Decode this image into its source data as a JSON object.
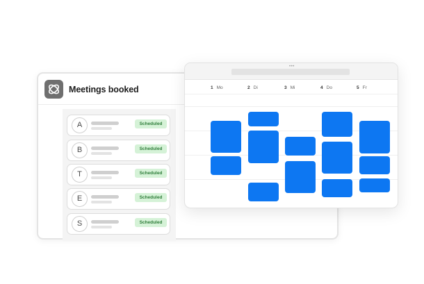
{
  "meetings": {
    "title": "Meetings booked",
    "app_icon": "orbit-logo-icon",
    "contacts": [
      {
        "initial": "A",
        "status": "Scheduled"
      },
      {
        "initial": "B",
        "status": "Scheduled"
      },
      {
        "initial": "T",
        "status": "Scheduled"
      },
      {
        "initial": "E",
        "status": "Scheduled"
      },
      {
        "initial": "S",
        "status": "Scheduled"
      }
    ]
  },
  "calendar": {
    "window_dots": "•••",
    "days": [
      {
        "num": "1",
        "name": "Mo"
      },
      {
        "num": "2",
        "name": "Di"
      },
      {
        "num": "3",
        "name": "Mi"
      },
      {
        "num": "4",
        "name": "Do"
      },
      {
        "num": "5",
        "name": "Fr"
      }
    ]
  },
  "colors": {
    "event_blue": "#0d77f2",
    "badge_green_bg": "#d5f2d7",
    "badge_green_text": "#2f7d3a"
  }
}
